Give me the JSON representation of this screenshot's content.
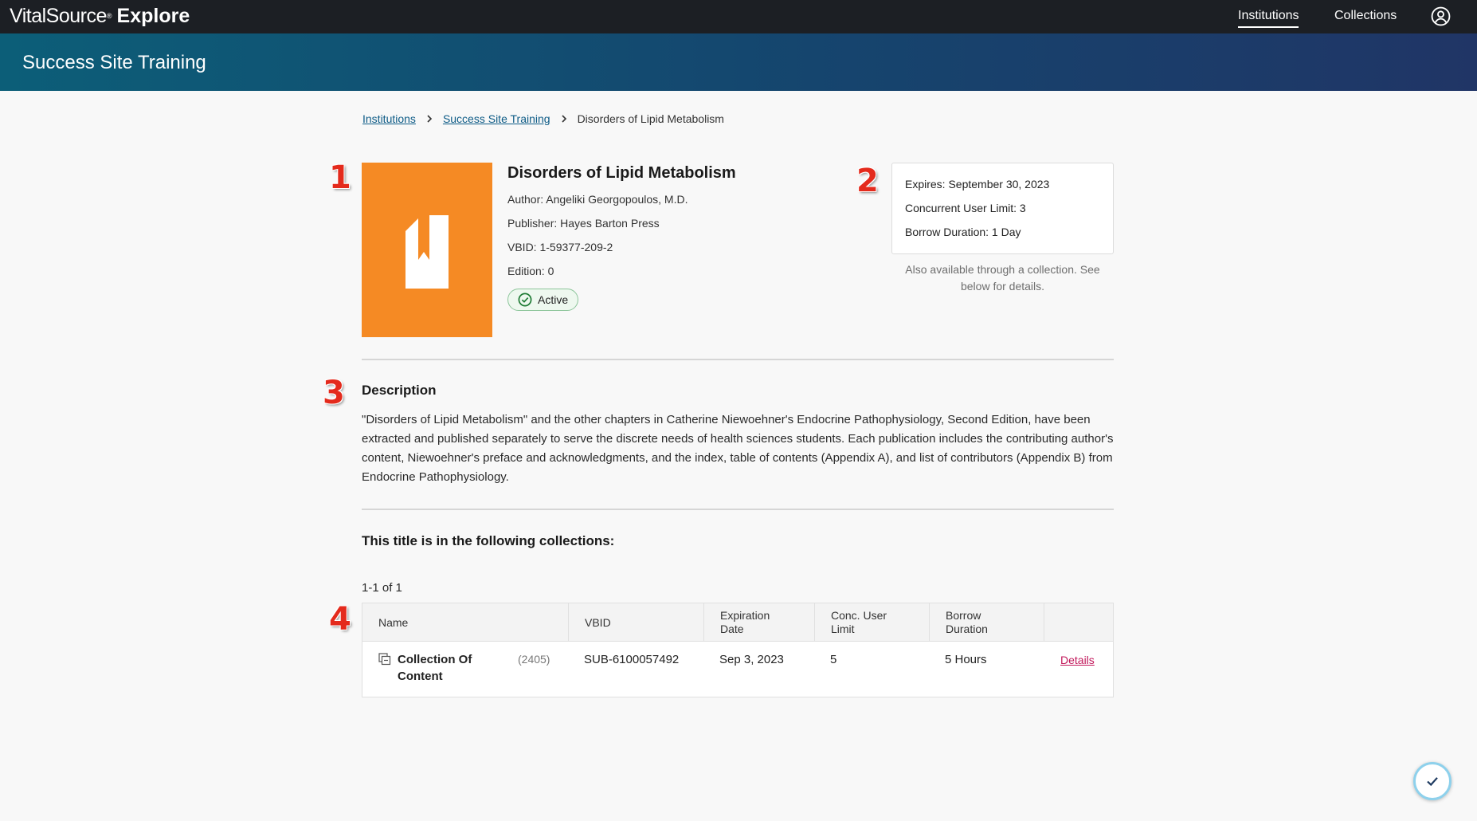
{
  "topbar": {
    "brand": "VitalSource",
    "brand_mark": "®",
    "product": "Explore",
    "nav": [
      {
        "label": "Institutions",
        "active": true
      },
      {
        "label": "Collections",
        "active": false
      }
    ],
    "user_icon": "user-circle-icon"
  },
  "banner": {
    "title": "Success Site Training"
  },
  "breadcrumb": {
    "items": [
      "Institutions",
      "Success Site Training"
    ],
    "current": "Disorders of Lipid Metabolism"
  },
  "markers": [
    "1",
    "2",
    "3",
    "4"
  ],
  "book": {
    "title": "Disorders of Lipid Metabolism",
    "author": "Author: Angeliki Georgopoulos, M.D.",
    "publisher": "Publisher: Hayes Barton Press",
    "vbid": "VBID: 1-59377-209-2",
    "edition": "Edition: 0",
    "status": "Active",
    "cover_color": "#f58a24"
  },
  "license": {
    "expires": "Expires: September 30, 2023",
    "concurrent": "Concurrent User Limit: 3",
    "borrow": "Borrow Duration: 1 Day",
    "note": "Also available through a collection. See below for details."
  },
  "description": {
    "heading": "Description",
    "text": "\"Disorders of Lipid Metabolism\" and the other chapters in Catherine Niewoehner's Endocrine Pathophysiology, Second Edition, have been extracted and published separately to serve the discrete needs of health sciences students. Each publication includes the contributing author's content, Niewoehner's preface and acknowledgments, and the index, table of contents (Appendix A), and list of contributors (Appendix B) from Endocrine Pathophysiology."
  },
  "collections": {
    "heading": "This title is in the following collections:",
    "count": "1-1 of 1",
    "columns": [
      "Name",
      "VBID",
      "Expiration Date",
      "Conc. User Limit",
      "Borrow Duration"
    ],
    "rows": [
      {
        "name": "Collection Of Content",
        "count": "(2405)",
        "vbid": "SUB-6100057492",
        "expiration": "Sep 3, 2023",
        "limit": "5",
        "borrow": "5 Hours",
        "action": "Details"
      }
    ]
  }
}
